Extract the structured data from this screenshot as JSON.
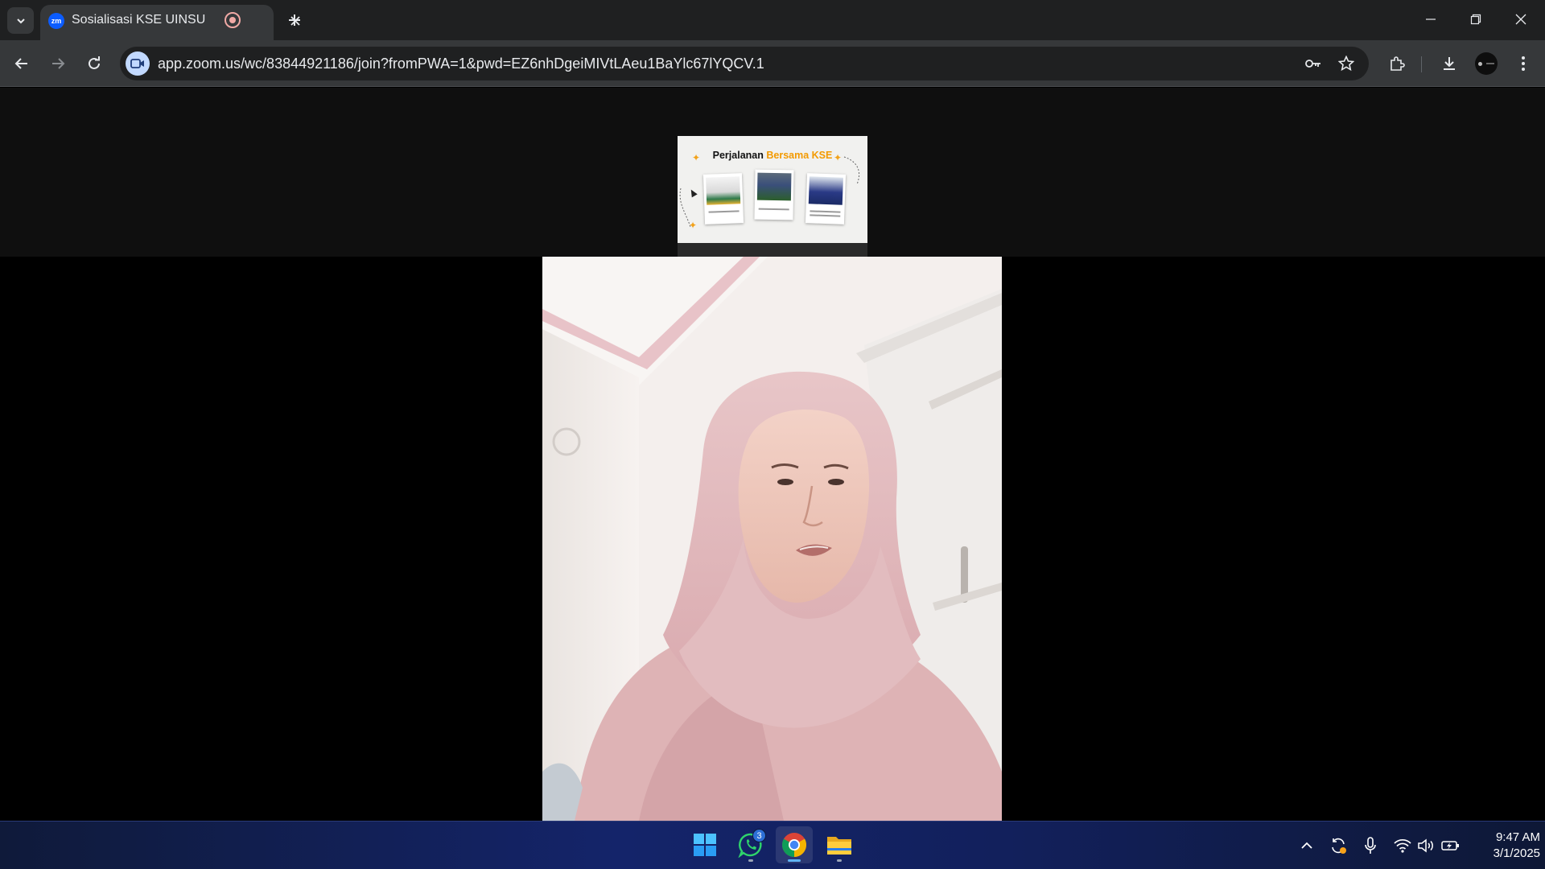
{
  "browser": {
    "tab": {
      "favicon_text": "zm",
      "title": "Sosialisasi KSE UINSU"
    },
    "address_bar": {
      "url": "app.zoom.us/wc/83844921186/join?fromPWA=1&pwd=EZ6nhDgeiMIVtLAeu1BaYlc67lYQCV.1"
    }
  },
  "meeting": {
    "shared_slide": {
      "title_part1": "Perjalanan",
      "title_part2": "Bersama KSE"
    }
  },
  "taskbar": {
    "apps": [
      {
        "name": "Start",
        "icon": "windows-icon"
      },
      {
        "name": "WhatsApp",
        "icon": "whatsapp-icon",
        "badge": "3"
      },
      {
        "name": "Google Chrome",
        "icon": "chrome-icon"
      },
      {
        "name": "File Explorer",
        "icon": "folder-icon"
      }
    ],
    "clock": {
      "time": "9:47 AM",
      "date": "3/1/2025"
    }
  },
  "colors": {
    "tab_strip": "#1f2021",
    "toolbar": "#36383a",
    "zoom_brand": "#0b5cff",
    "slide_highlight": "#f39a00"
  }
}
